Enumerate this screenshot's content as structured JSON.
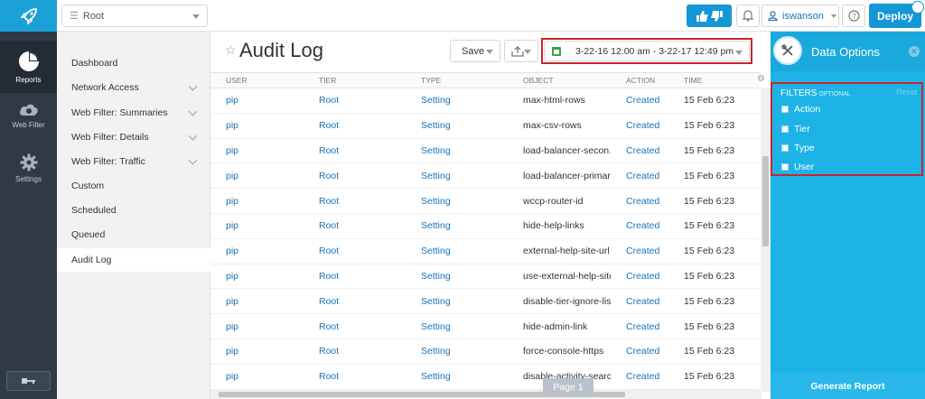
{
  "rail": {
    "items": [
      {
        "label": "Reports",
        "icon": "pie-chart-icon"
      },
      {
        "label": "Web Filter",
        "icon": "cloud-icon"
      },
      {
        "label": "Settings",
        "icon": "gear-icon"
      }
    ]
  },
  "topbar": {
    "root_select": "Root",
    "user_name": "iswanson",
    "deploy_label": "Deploy"
  },
  "subnav": {
    "items": [
      {
        "label": "Dashboard"
      },
      {
        "label": "Network Access"
      },
      {
        "label": "Web Filter: Summaries"
      },
      {
        "label": "Web Filter: Details"
      },
      {
        "label": "Web Filter: Traffic"
      },
      {
        "label": "Custom"
      },
      {
        "label": "Scheduled"
      },
      {
        "label": "Queued"
      },
      {
        "label": "Audit Log"
      }
    ]
  },
  "main": {
    "title": "Audit Log",
    "save_label": "Save",
    "date_range": "3-22-16 12:00 am - 3-22-17 12:49 pm",
    "page_label": "Page 1",
    "columns": [
      "USER",
      "TIER",
      "TYPE",
      "OBJECT",
      "ACTION",
      "TIME"
    ],
    "rows": [
      [
        "pip",
        "Root",
        "Setting",
        "max-html-rows",
        "Created",
        "15 Feb 6:23"
      ],
      [
        "pip",
        "Root",
        "Setting",
        "max-csv-rows",
        "Created",
        "15 Feb 6:23"
      ],
      [
        "pip",
        "Root",
        "Setting",
        "load-balancer-secon…",
        "Created",
        "15 Feb 6:23"
      ],
      [
        "pip",
        "Root",
        "Setting",
        "load-balancer-primary",
        "Created",
        "15 Feb 6:23"
      ],
      [
        "pip",
        "Root",
        "Setting",
        "wccp-router-id",
        "Created",
        "15 Feb 6:23"
      ],
      [
        "pip",
        "Root",
        "Setting",
        "hide-help-links",
        "Created",
        "15 Feb 6:23"
      ],
      [
        "pip",
        "Root",
        "Setting",
        "external-help-site-url",
        "Created",
        "15 Feb 6:23"
      ],
      [
        "pip",
        "Root",
        "Setting",
        "use-external-help-site",
        "Created",
        "15 Feb 6:23"
      ],
      [
        "pip",
        "Root",
        "Setting",
        "disable-tier-ignore-lists",
        "Created",
        "15 Feb 6:23"
      ],
      [
        "pip",
        "Root",
        "Setting",
        "hide-admin-link",
        "Created",
        "15 Feb 6:23"
      ],
      [
        "pip",
        "Root",
        "Setting",
        "force-console-https",
        "Created",
        "15 Feb 6:23"
      ],
      [
        "pip",
        "Root",
        "Setting",
        "disable-activity-search",
        "Created",
        "15 Feb 6:23"
      ]
    ]
  },
  "panel": {
    "title": "Data Options",
    "filters_title": "FILTERS",
    "filters_optional": "OPTIONAL",
    "reset_label": "Reset",
    "filters": [
      "Action",
      "Tier",
      "Type",
      "User"
    ],
    "generate_label": "Generate Report"
  },
  "colors": {
    "accent": "#1597d6",
    "panel": "#1db3e6",
    "rail": "#2f3a44",
    "highlight": "#c9252b",
    "link": "#1a73b9"
  }
}
